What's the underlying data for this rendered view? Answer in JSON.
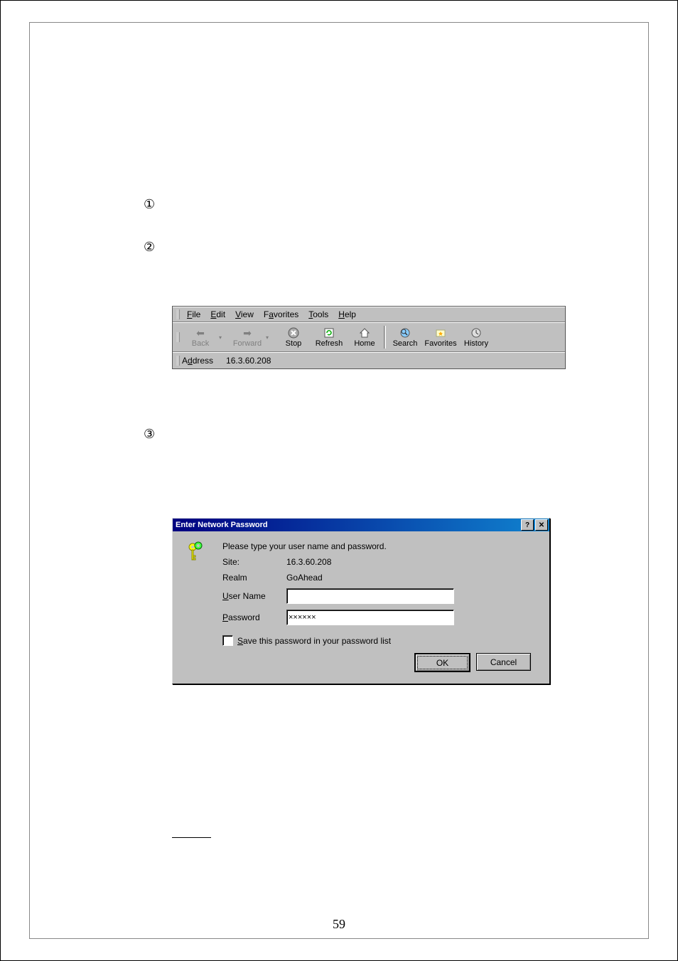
{
  "markers": {
    "m1": "①",
    "m2": "②",
    "m3": "③"
  },
  "ie": {
    "menu": {
      "file": "File",
      "edit": "Edit",
      "view": "View",
      "favorites": "Favorites",
      "tools": "Tools",
      "help": "Help"
    },
    "buttons": {
      "back": "Back",
      "forward": "Forward",
      "stop": "Stop",
      "refresh": "Refresh",
      "home": "Home",
      "search": "Search",
      "favorites": "Favorites",
      "history": "History"
    },
    "address_label": "Address",
    "address_value": "16.3.60.208"
  },
  "dialog": {
    "title": "Enter Network Password",
    "instruction": "Please type your user name and password.",
    "site_label": "Site:",
    "site_value": "16.3.60.208",
    "realm_label": "Realm",
    "realm_value": "GoAhead",
    "username_label": "User Name",
    "username_value": "",
    "password_label": "Password",
    "password_value": "××××××",
    "save_label": "Save this password in your password list",
    "ok_label": "OK",
    "cancel_label": "Cancel"
  },
  "page_number": "59"
}
